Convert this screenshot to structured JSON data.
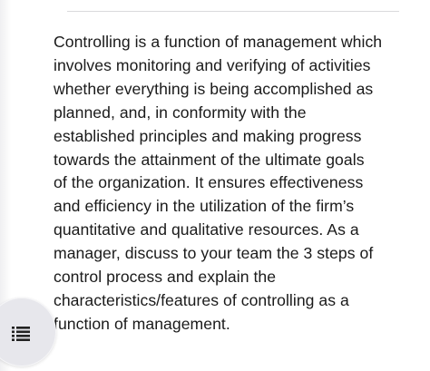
{
  "question": {
    "lines": [
      "Controlling is a function of management which",
      "involves monitoring and verifying of activities",
      "whether everything is being accomplished as",
      "planned, and, in conformity with the",
      "established principles and making progress",
      "towards the attainment of the ultimate goals",
      "of the organization.  It ensures effectiveness",
      "and efficiency in the utilization of the firm’s",
      "quantitative and qualitative resources. As a",
      "manager, discuss to your team the 3 steps of",
      "control process and explain the",
      "characteristics/features of controlling as a",
      "function of management."
    ]
  },
  "floating_button": {
    "icon": "list-icon"
  },
  "colors": {
    "text": "#1a1a1a",
    "background": "#ffffff",
    "button_background": "#e7e7ec",
    "icon": "#222222",
    "divider": "#d9d9dc"
  }
}
